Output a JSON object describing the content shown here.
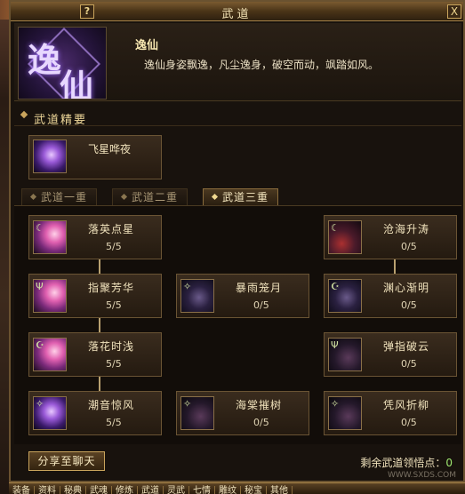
{
  "window": {
    "title": "武道",
    "help_label": "?",
    "close_label": "X"
  },
  "header": {
    "emblem_chars": [
      "逸",
      "仙"
    ],
    "style_name": "逸仙",
    "style_desc": "逸仙身姿飘逸，凡尘逸身，破空而动，飒踏如风。"
  },
  "essence": {
    "section_title": "武道精要",
    "skill": {
      "name": "飞星哗夜",
      "icon": "violet-dash-icon"
    }
  },
  "tabs": [
    {
      "label": "武道一重",
      "active": false
    },
    {
      "label": "武道二重",
      "active": false
    },
    {
      "label": "武道三重",
      "active": true
    }
  ],
  "skills": {
    "left": [
      {
        "name": "落英点星",
        "level": "5/5",
        "icon": "pink-flame-icon",
        "glyph": "☾"
      },
      {
        "name": "指聚芳华",
        "level": "5/5",
        "icon": "pink-palm-icon",
        "glyph": "Ψ"
      },
      {
        "name": "落花时浅",
        "level": "5/5",
        "icon": "pink-petal-icon",
        "glyph": "☪"
      },
      {
        "name": "潮音惊风",
        "level": "5/5",
        "icon": "violet-wave-icon",
        "glyph": "✧"
      }
    ],
    "middle": [
      {
        "name": "暴雨笼月",
        "level": "0/5",
        "icon": "dark-rain-icon",
        "glyph": "✧"
      },
      {
        "name": "海棠摧树",
        "level": "0/5",
        "icon": "dark-tree-icon",
        "glyph": "✧"
      }
    ],
    "right": [
      {
        "name": "沧海升涛",
        "level": "0/5",
        "icon": "red-wave-icon",
        "glyph": "☾"
      },
      {
        "name": "渊心渐明",
        "level": "0/5",
        "icon": "dark-heart-icon",
        "glyph": "☪"
      },
      {
        "name": "弹指破云",
        "level": "0/5",
        "icon": "dark-cloud-icon",
        "glyph": "Ψ"
      },
      {
        "name": "凭风折柳",
        "level": "0/5",
        "icon": "dark-willow-icon",
        "glyph": "✧"
      }
    ]
  },
  "footer": {
    "share_label": "分享至聊天",
    "points_label": "剩余武道领悟点：",
    "points_value": "0"
  },
  "bottombar": {
    "items": [
      "装备",
      "资料",
      "秘典",
      "武魂",
      "修炼",
      "武道",
      "灵武",
      "七情",
      "雕纹",
      "秘宝",
      "其他"
    ]
  },
  "watermark": "WWW.SXDS.COM",
  "colors": {
    "gold_border": "#c9a45c",
    "text_light": "#f0e2bc",
    "panel_bg": "#18120d"
  }
}
